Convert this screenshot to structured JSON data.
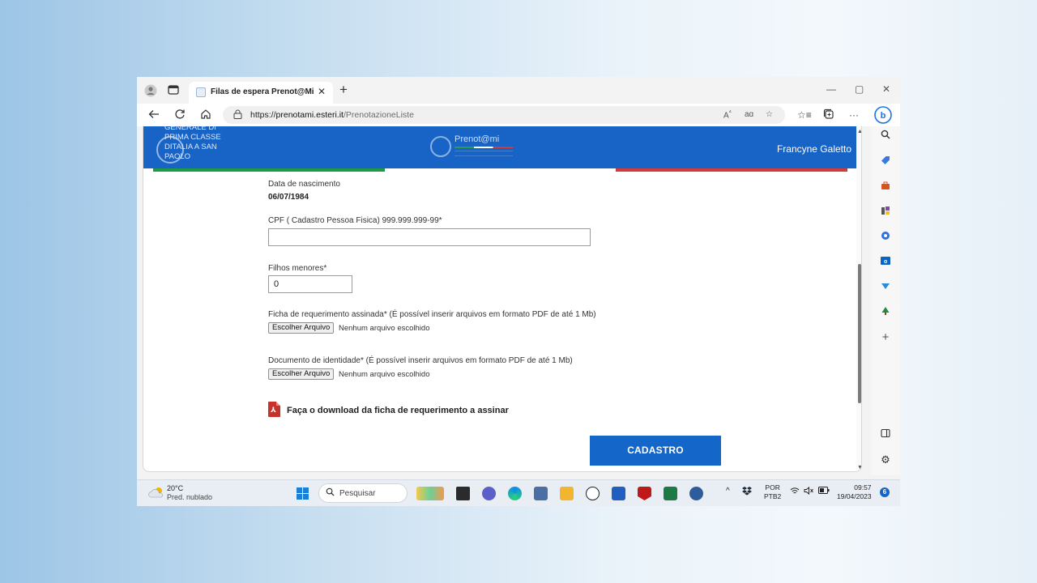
{
  "browser": {
    "tab_title": "Filas de espera Prenot@Mi",
    "tab_close": "✕",
    "new_tab": "+",
    "window_controls": {
      "minimize": "—",
      "restore": "▢",
      "close": "✕"
    },
    "url_scheme": "https://",
    "url_host": "prenotami.esteri.it",
    "url_path": "/PrenotazioneListe",
    "nav_icons": [
      "back-arrow-icon",
      "refresh-icon",
      "home-icon",
      "lock-icon"
    ],
    "url_action_icons": [
      "read-aloud-icon",
      "translate-icon",
      "favorite-add-icon"
    ],
    "toolbar_icons": [
      "favorites-icon",
      "collections-icon",
      "more-icon",
      "bing-chat-icon"
    ],
    "sidebar_icons": [
      "search-icon",
      "shopping-tag-icon",
      "tools-icon",
      "games-icon",
      "microsoft365-icon",
      "outlook-icon",
      "drop-icon",
      "tree-icon",
      "add-icon",
      "sidebar-toggle-icon",
      "settings-icon"
    ],
    "colors": {
      "accent": "#1763c6",
      "flag_green": "#1e9a46",
      "flag_white": "#ffffff",
      "flag_red": "#d23b3b"
    }
  },
  "site": {
    "header_logo_text": "GENERALE DI PRIMA CLASSE DITALIA A SAN PAOLO",
    "brand_name": "Prenot@mi",
    "user_name": "Francyne Galetto"
  },
  "form": {
    "birth_label": "Data de nascimento",
    "birth_value": "06/07/1984",
    "cpf_label": "CPF ( Cadastro Pessoa Fisica) 999.999.999-99*",
    "cpf_value": "",
    "children_label": "Filhos menores*",
    "children_value": "0",
    "signed_form_label": "Ficha de requerimento assinada* (É possível inserir arquivos em formato PDF de até 1 Mb)",
    "signed_form_button": "Escolher Arquivo",
    "signed_form_status": "Nenhum arquivo escolhido",
    "id_doc_label": "Documento de identidade* (É possível inserir arquivos em formato PDF de até 1 Mb)",
    "id_doc_button": "Escolher Arquivo",
    "id_doc_status": "Nenhum arquivo escolhido",
    "download_text": "Faça o download da ficha de requerimento a assinar",
    "submit_label": "CADASTRO"
  },
  "taskbar": {
    "weather_temp": "20°C",
    "weather_desc": "Pred. nublado",
    "search_placeholder": "Pesquisar",
    "lang_line1": "POR",
    "lang_line2": "PTB2",
    "time": "09:57",
    "date": "19/04/2023",
    "notification_count": "6"
  }
}
